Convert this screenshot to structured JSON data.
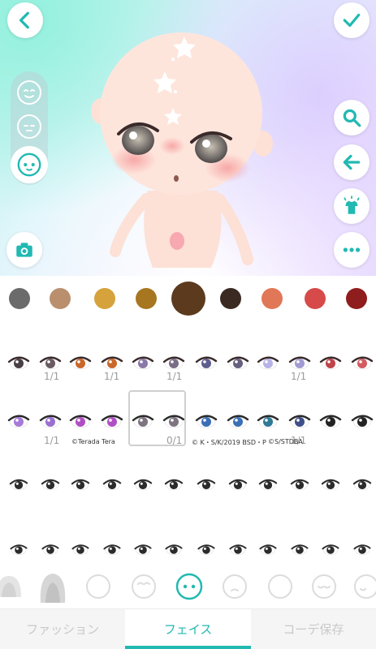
{
  "toolbar": {
    "back_icon": "chevron-left-icon",
    "confirm_icon": "checkmark-icon",
    "search_icon": "magnifier-icon",
    "undo_icon": "arrow-left-icon",
    "outfit_icon": "shirt-icon",
    "more_icon": "dots-icon",
    "camera_icon": "camera-icon"
  },
  "face_strip": {
    "items": [
      "smile-face",
      "neutral-face",
      "selected-face"
    ],
    "active_index": 2
  },
  "colors": {
    "accent": "#21b9b2",
    "swatches": [
      "#6b6b6b",
      "#b98f6e",
      "#d6a23c",
      "#a77620",
      "#5b3a1e",
      "#3b2a22",
      "#e07757",
      "#d64a4a",
      "#8f1d1d"
    ],
    "selected_index": 4
  },
  "eyes": {
    "row1_counts": [
      "1/1",
      "1/1",
      "1/1",
      "1/1"
    ],
    "row2_counts": [
      "1/1",
      "0/1",
      "1/1"
    ],
    "copyrights": [
      "©Terada Tera",
      "© K・S/K/2019 BSD・P",
      "©S/STDBA"
    ]
  },
  "shapes": {
    "items": [
      "hair-bangs",
      "hair-long",
      "face-plain",
      "face-smile",
      "face-dots",
      "face-frown",
      "face-pout",
      "face-sad",
      "face-grin"
    ],
    "selected_index": 4
  },
  "tabs": {
    "fashion": "ファッション",
    "face": "フェイス",
    "save": "コーデ保存",
    "active": "face"
  }
}
